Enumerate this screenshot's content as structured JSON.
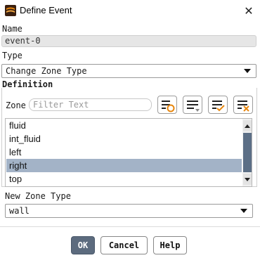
{
  "window": {
    "title": "Define Event",
    "icon": "app-logo-icon",
    "close_icon": "close-icon"
  },
  "name": {
    "label": "Name",
    "value": "event-0"
  },
  "type": {
    "label": "Type",
    "selected": "Change Zone Type"
  },
  "definition": {
    "heading": "Definition",
    "zone_label": "Zone",
    "filter_placeholder": "Filter Text",
    "tool_icons": [
      "select-all-zones-icon",
      "list-options-icon",
      "select-all-check-icon",
      "deselect-all-icon"
    ],
    "zones": [
      "fluid",
      "int_fluid",
      "left",
      "right",
      "top"
    ],
    "selected_zone": "right"
  },
  "new_zone_type": {
    "label": "New Zone Type",
    "selected": "wall"
  },
  "buttons": {
    "ok": "OK",
    "cancel": "Cancel",
    "help": "Help"
  },
  "colors": {
    "selection": "#a3b3c7",
    "primary_button": "#5c6b7e",
    "scroll_thumb": "#5c6f86",
    "accent_orange": "#e8870e"
  }
}
